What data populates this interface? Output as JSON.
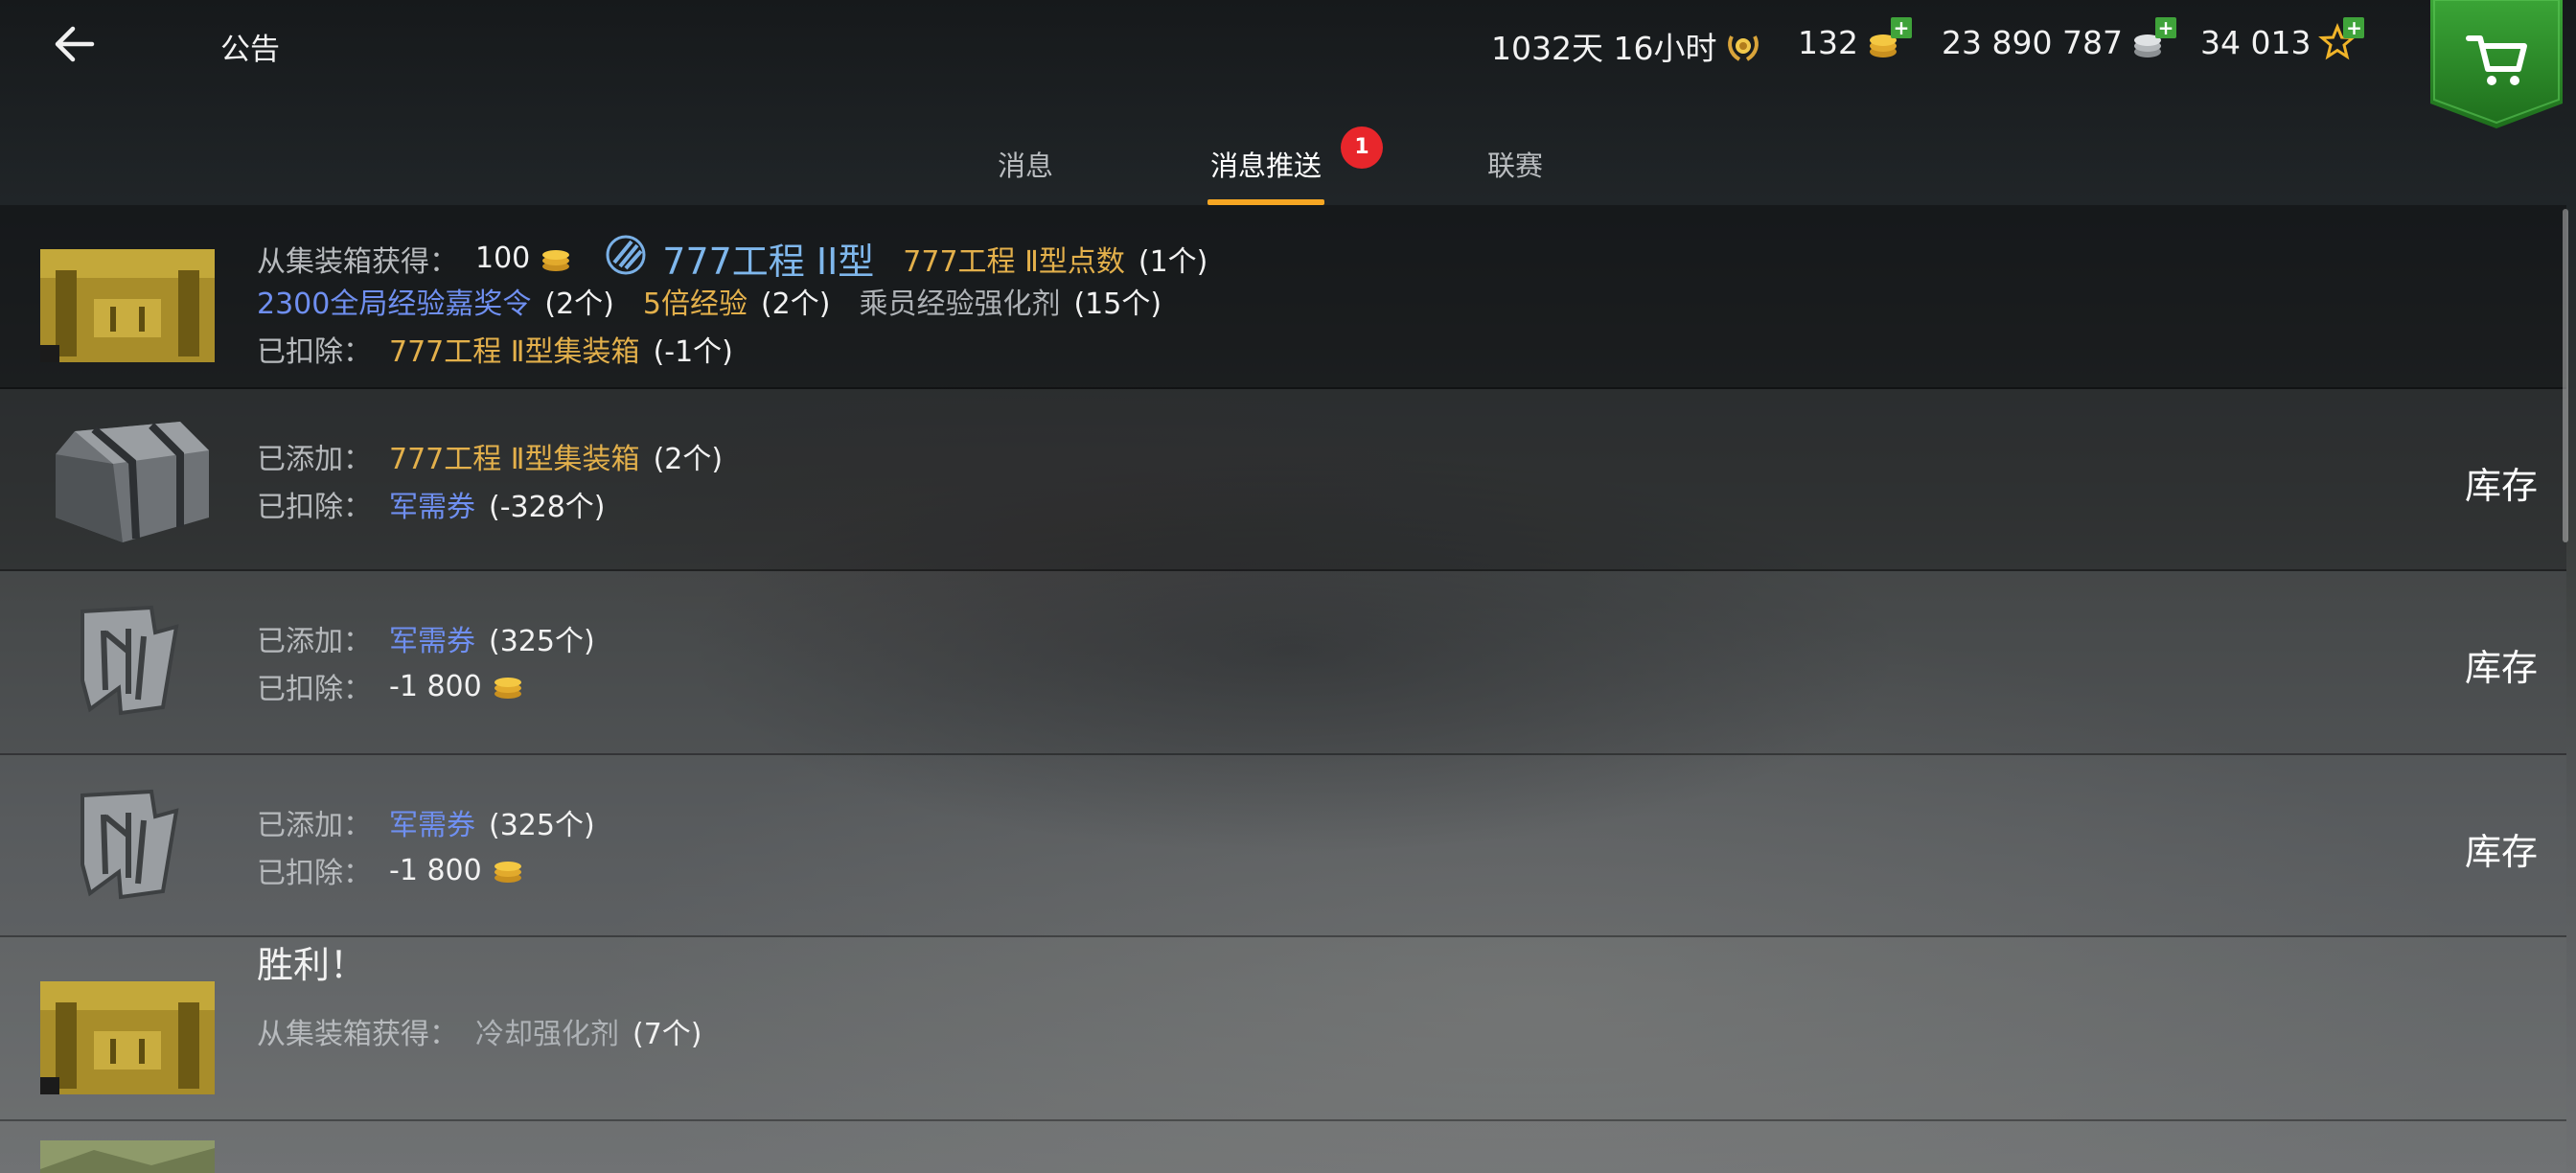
{
  "header": {
    "title": "公告",
    "premium_time": "1032天 16小时",
    "gold": "132",
    "credits": "23 890 787",
    "free_xp": "34 013"
  },
  "tabs": [
    {
      "label": "消息"
    },
    {
      "label": "消息推送",
      "badge": "1",
      "active": true
    },
    {
      "label": "联赛"
    }
  ],
  "notifications": [
    {
      "line1_label": "从集装箱获得：",
      "line1_gold": "100",
      "tank_name": "777工程 II型",
      "tank_points": "777工程 Ⅱ型点数",
      "tank_points_count": "(1个)",
      "reward1": "2300全局经验嘉奖令",
      "reward1_count": "(2个)",
      "reward2": "5倍经验",
      "reward2_count": "(2个)",
      "reward3": "乘员经验强化剂",
      "reward3_count": "(15个)",
      "line3_label": "已扣除：",
      "line3_item": "777工程 Ⅱ型集装箱",
      "line3_count": "(-1个)"
    },
    {
      "line1_label": "已添加：",
      "line1_item": "777工程 Ⅱ型集装箱",
      "line1_count": "(2个)",
      "line2_label": "已扣除：",
      "line2_item": "军需券",
      "line2_count": "(-328个)",
      "action": "库存"
    },
    {
      "line1_label": "已添加：",
      "line1_item": "军需券",
      "line1_count": "(325个)",
      "line2_label": "已扣除：",
      "line2_value": "-1 800",
      "action": "库存"
    },
    {
      "line1_label": "已添加：",
      "line1_item": "军需券",
      "line1_count": "(325个)",
      "line2_label": "已扣除：",
      "line2_value": "-1 800",
      "action": "库存"
    },
    {
      "line1_label": "从集装箱获得：",
      "line1_item": "冷却强化剂",
      "line1_count": "(7个)"
    },
    {
      "title": "胜利！"
    }
  ],
  "colors": {
    "tab_underline": "#f5a623",
    "badge": "#e8262b",
    "gold_text": "#e3b04b",
    "blue_text": "#6f8ff0",
    "shop_green": "#2e8b2a"
  }
}
